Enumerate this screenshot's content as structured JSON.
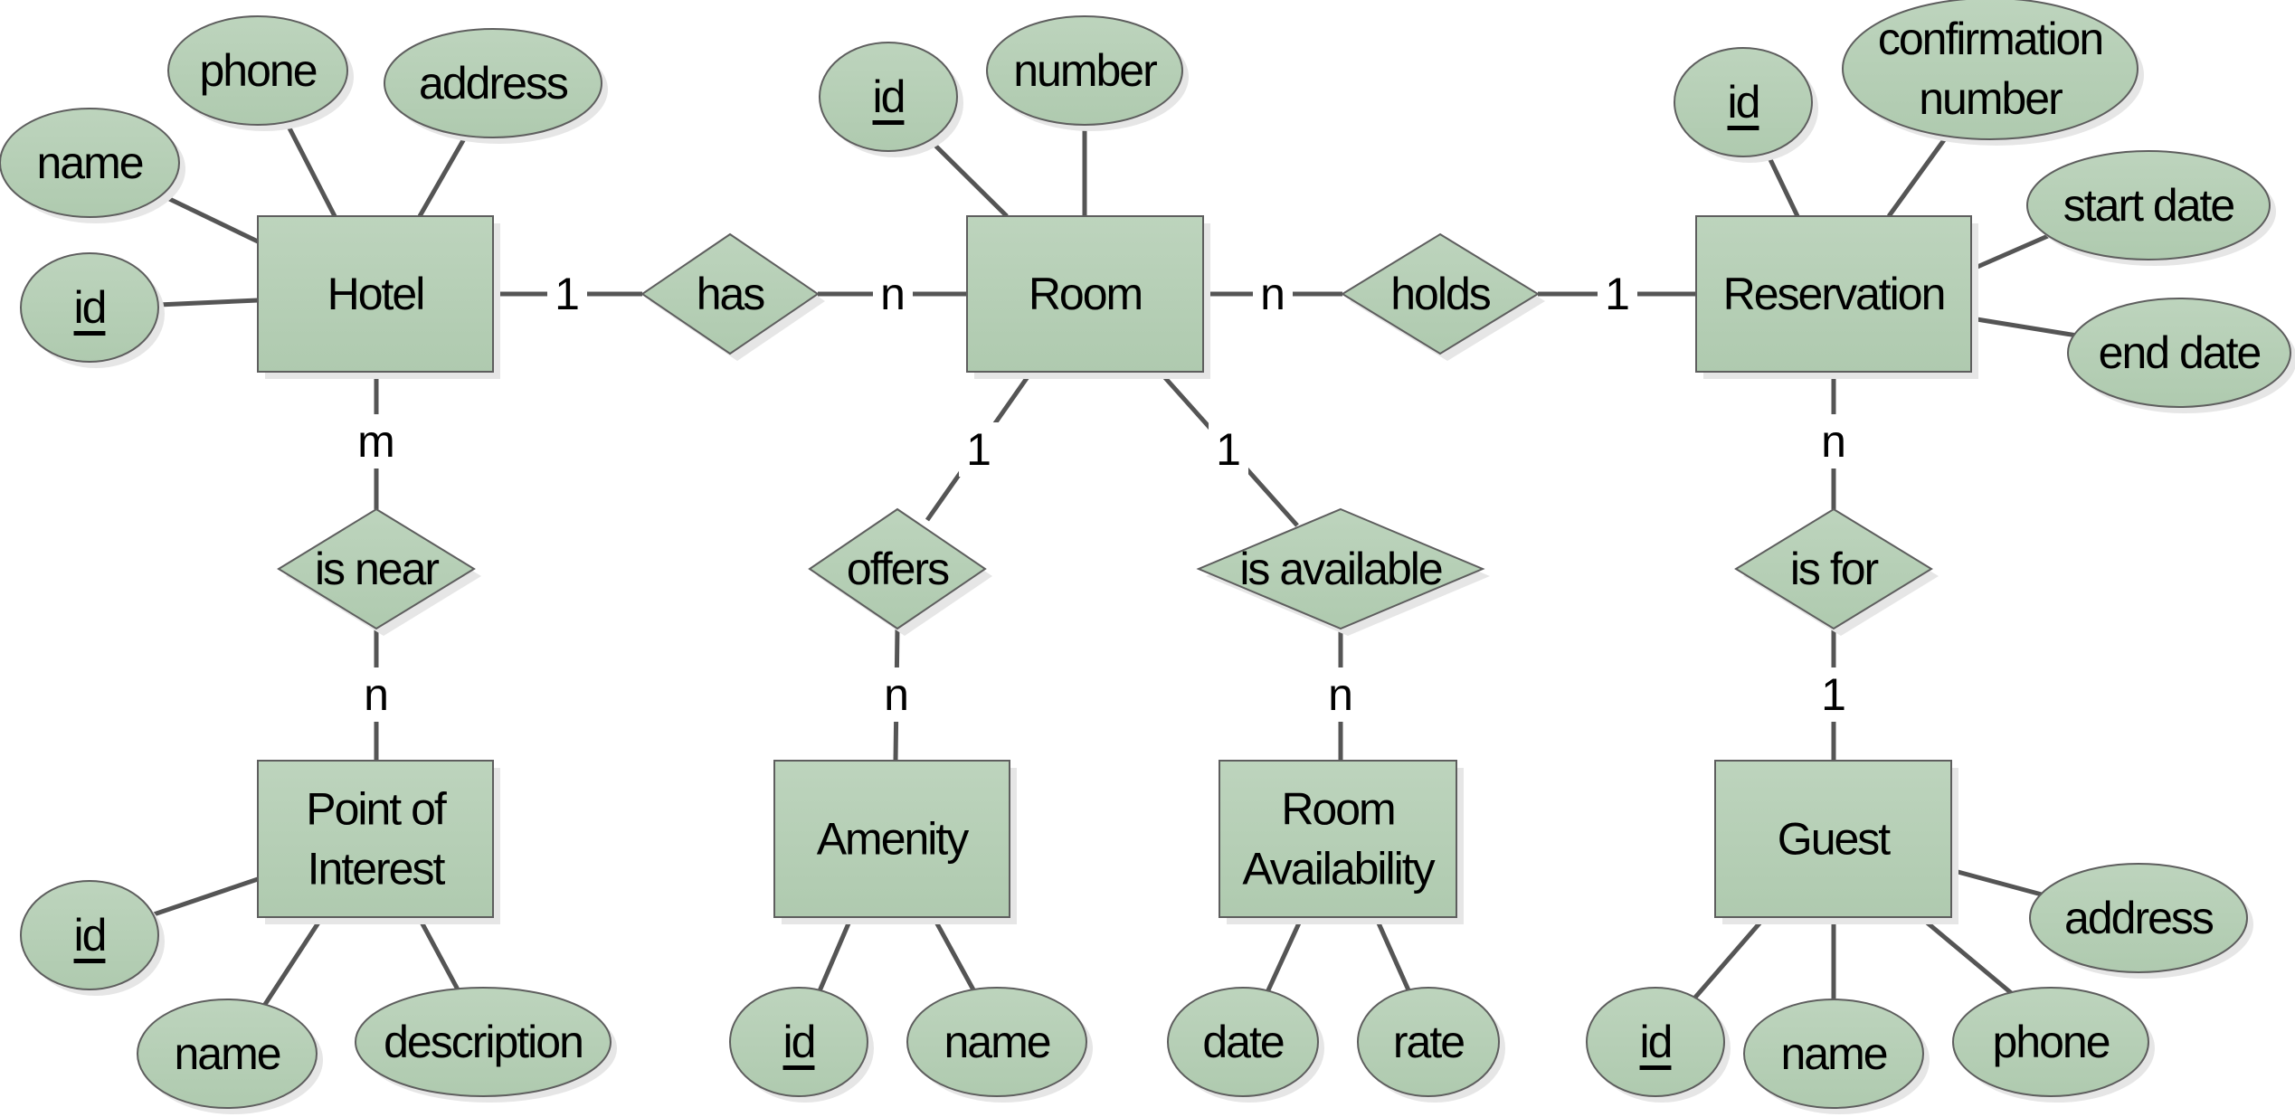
{
  "diagram": {
    "type": "entity-relationship",
    "colors": {
      "fill_top": "#bdd4bd",
      "fill_bottom": "#afcaaf",
      "stroke": "#5e5e5e",
      "edge": "#555555",
      "shadow": "#e6e6e6"
    },
    "entities": [
      {
        "id": "hotel",
        "label": [
          "Hotel"
        ]
      },
      {
        "id": "room",
        "label": [
          "Room"
        ]
      },
      {
        "id": "reservation",
        "label": [
          "Reservation"
        ]
      },
      {
        "id": "poi",
        "label": [
          "Point of",
          "Interest"
        ]
      },
      {
        "id": "amenity",
        "label": [
          "Amenity"
        ]
      },
      {
        "id": "roomavail",
        "label": [
          "Room",
          "Availability"
        ]
      },
      {
        "id": "guest",
        "label": [
          "Guest"
        ]
      }
    ],
    "relationships": [
      {
        "id": "has",
        "label": "has",
        "from": "hotel",
        "from_card": "1",
        "to": "room",
        "to_card": "n"
      },
      {
        "id": "holds",
        "label": "holds",
        "from": "room",
        "from_card": "n",
        "to": "reservation",
        "to_card": "1"
      },
      {
        "id": "isnear",
        "label": "is near",
        "from": "hotel",
        "from_card": "m",
        "to": "poi",
        "to_card": "n"
      },
      {
        "id": "offers",
        "label": "offers",
        "from": "room",
        "from_card": "1",
        "to": "amenity",
        "to_card": "n"
      },
      {
        "id": "isavailable",
        "label": "is available",
        "from": "room",
        "from_card": "1",
        "to": "roomavail",
        "to_card": "n"
      },
      {
        "id": "isfor",
        "label": "is for",
        "from": "reservation",
        "from_card": "n",
        "to": "guest",
        "to_card": "1"
      }
    ],
    "attributes": [
      {
        "id": "hotel-phone",
        "entity": "hotel",
        "label": [
          "phone"
        ],
        "key": false
      },
      {
        "id": "hotel-address",
        "entity": "hotel",
        "label": [
          "address"
        ],
        "key": false
      },
      {
        "id": "hotel-name",
        "entity": "hotel",
        "label": [
          "name"
        ],
        "key": false
      },
      {
        "id": "hotel-id",
        "entity": "hotel",
        "label": [
          "id"
        ],
        "key": true
      },
      {
        "id": "room-id",
        "entity": "room",
        "label": [
          "id"
        ],
        "key": true
      },
      {
        "id": "room-number",
        "entity": "room",
        "label": [
          "number"
        ],
        "key": false
      },
      {
        "id": "res-id",
        "entity": "reservation",
        "label": [
          "id"
        ],
        "key": true
      },
      {
        "id": "res-conf",
        "entity": "reservation",
        "label": [
          "confirmation",
          "number"
        ],
        "key": false
      },
      {
        "id": "res-start",
        "entity": "reservation",
        "label": [
          "start date"
        ],
        "key": false
      },
      {
        "id": "res-end",
        "entity": "reservation",
        "label": [
          "end date"
        ],
        "key": false
      },
      {
        "id": "poi-id",
        "entity": "poi",
        "label": [
          "id"
        ],
        "key": true
      },
      {
        "id": "poi-name",
        "entity": "poi",
        "label": [
          "name"
        ],
        "key": false
      },
      {
        "id": "poi-desc",
        "entity": "poi",
        "label": [
          "description"
        ],
        "key": false
      },
      {
        "id": "amenity-id",
        "entity": "amenity",
        "label": [
          "id"
        ],
        "key": true
      },
      {
        "id": "amenity-name",
        "entity": "amenity",
        "label": [
          "name"
        ],
        "key": false
      },
      {
        "id": "ra-date",
        "entity": "roomavail",
        "label": [
          "date"
        ],
        "key": false
      },
      {
        "id": "ra-rate",
        "entity": "roomavail",
        "label": [
          "rate"
        ],
        "key": false
      },
      {
        "id": "guest-address",
        "entity": "guest",
        "label": [
          "address"
        ],
        "key": false
      },
      {
        "id": "guest-id",
        "entity": "guest",
        "label": [
          "id"
        ],
        "key": true
      },
      {
        "id": "guest-name",
        "entity": "guest",
        "label": [
          "name"
        ],
        "key": false
      },
      {
        "id": "guest-phone",
        "entity": "guest",
        "label": [
          "phone"
        ],
        "key": false
      }
    ]
  }
}
